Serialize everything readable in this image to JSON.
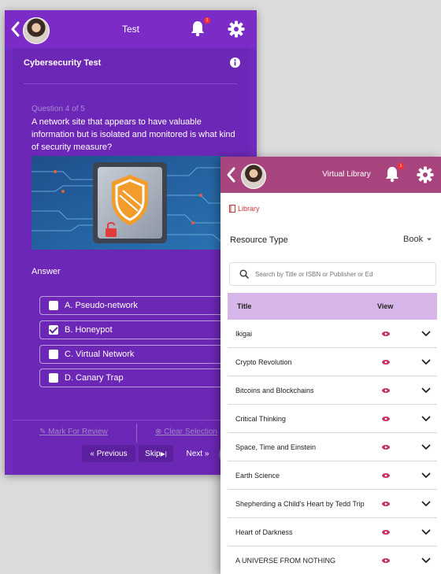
{
  "test_screen": {
    "header": {
      "title": "Test",
      "notification_count": "1"
    },
    "test_name": "Cybersecurity Test",
    "question_number": "Question 4 of 5",
    "question_text": "A network site that appears to have valuable information but is isolated and monitored is what kind of security measure?",
    "answer_label": "Answer",
    "options": [
      {
        "label": "A.  Pseudo-network",
        "checked": false
      },
      {
        "label": "B.  Honeypot",
        "checked": true
      },
      {
        "label": "C.  Virtual Network",
        "checked": false
      },
      {
        "label": "D.  Canary Trap",
        "checked": false
      }
    ],
    "footer": {
      "mark_for_review": "Mark For Review",
      "clear_selection": "Clear Selection",
      "previous": "« Previous",
      "skip": "Skip",
      "next": "Next »"
    },
    "colors": {
      "background": "#6e2bbd",
      "header": "#7b2cc6"
    }
  },
  "library_screen": {
    "header": {
      "title": "Virtual Library",
      "notification_count": "1"
    },
    "breadcrumb": "Library",
    "resource_type_label": "Resource Type",
    "resource_type_value": "Book",
    "search_placeholder": "Search by Title or ISBN or Publisher or Ed",
    "table": {
      "columns": [
        "Title",
        "View"
      ],
      "rows": [
        "Ikigai",
        "Crypto Revolution",
        "Bitcoins and Blockchains",
        "Critical Thinking",
        "Space, Time and Einstein",
        "Earth Science",
        "Shepherding a Child's Heart by Tedd Trip",
        "Heart of Darkness",
        "A UNIVERSE FROM NOTHING"
      ]
    },
    "colors": {
      "header": "#a8457f",
      "table_header": "#d6b6e8",
      "eye_icon": "#c4345c"
    }
  }
}
